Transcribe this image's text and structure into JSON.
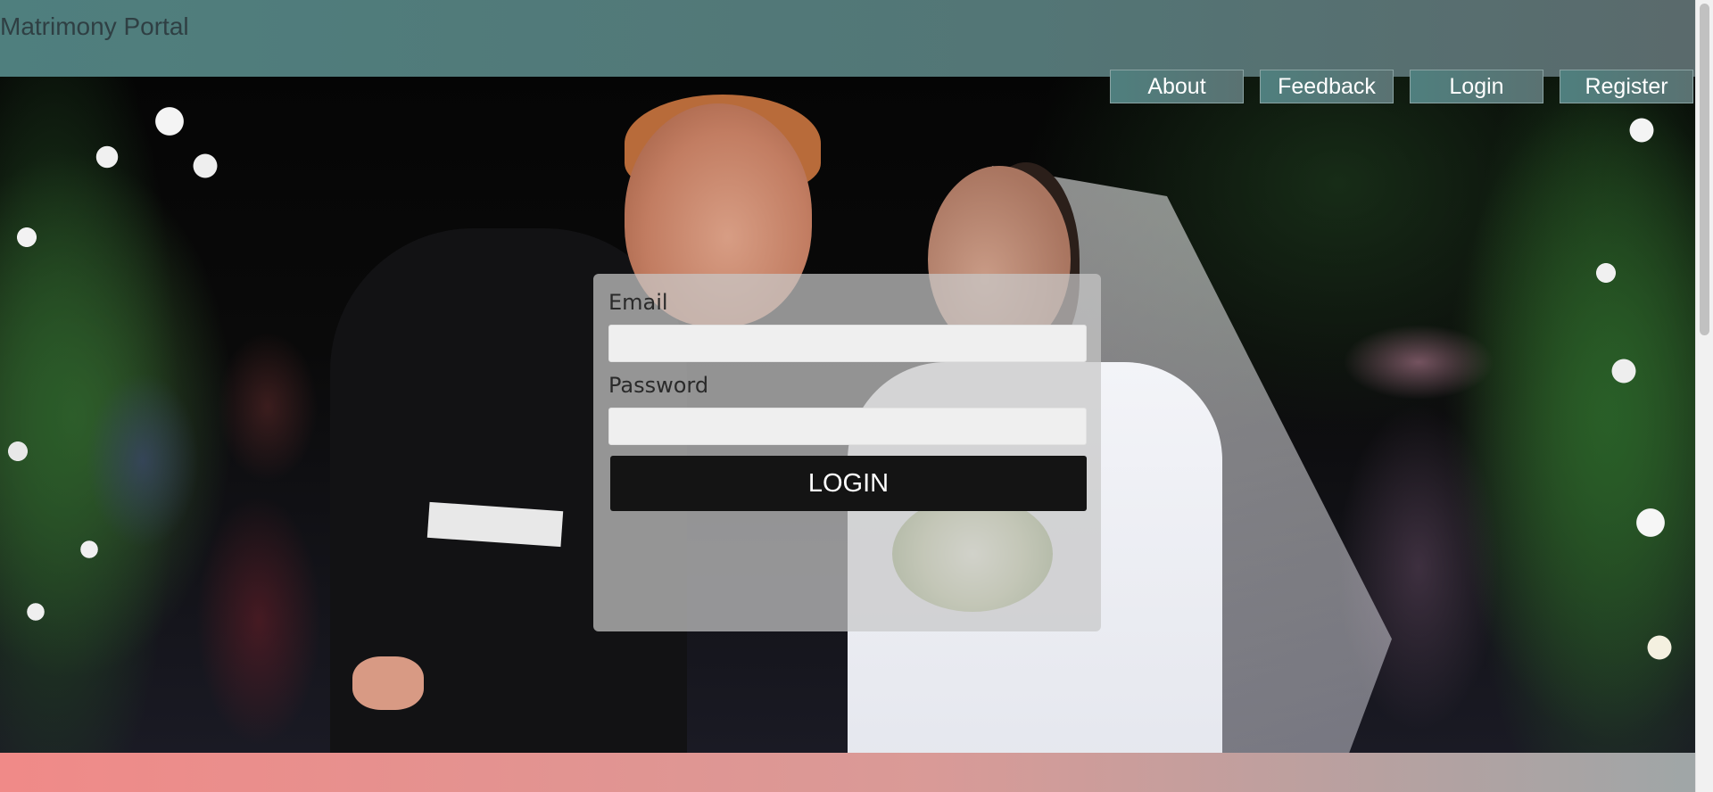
{
  "header": {
    "brand": "Matrimony Portal"
  },
  "nav": {
    "items": [
      {
        "label": "About"
      },
      {
        "label": "Feedback"
      },
      {
        "label": "Login"
      },
      {
        "label": "Register"
      }
    ]
  },
  "login_form": {
    "email_label": "Email",
    "email_value": "",
    "password_label": "Password",
    "password_value": "",
    "submit_label": "LOGIN"
  },
  "colors": {
    "header": "#537676",
    "nav_button": "#4f7f7e",
    "login_button": "#141414",
    "footer_start": "#f08a88",
    "footer_end": "#9fa6a7"
  }
}
